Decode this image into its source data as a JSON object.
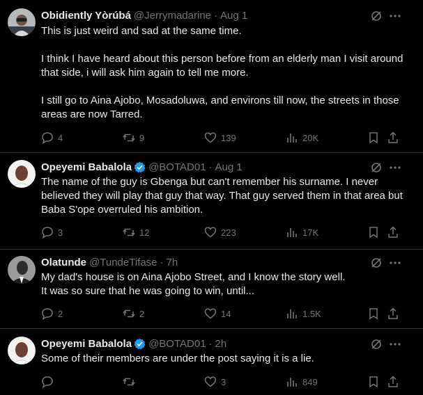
{
  "tweets": [
    {
      "name": "Obidiently Yòrúbá",
      "handle": "@Jerrymadarine",
      "dot": "·",
      "time": "Aug 1",
      "verified": false,
      "lines": [
        "This is just weird and sad at the same time.",
        "I think I have heard about this person before from an elderly man I visit around that side, i will ask him again to tell me more.",
        "I still go to Aina Ajobo, Mosadoluwa, and environs till now, the streets in those areas are now Tarred."
      ],
      "replies": "4",
      "reposts": "9",
      "likes": "139",
      "views": "20K"
    },
    {
      "name": "Opeyemi Babalola",
      "handle": "@BOTAD01",
      "dot": "·",
      "time": "Aug 1",
      "verified": true,
      "lines": [
        "The name of the guy is Gbenga but can't remember his surname. I never believed they will play that guy that way. That guy served them in that area but Baba S'ope overruled his ambition."
      ],
      "replies": "3",
      "reposts": "12",
      "likes": "223",
      "views": "17K"
    },
    {
      "name": "Olatunde",
      "handle": "@TundeTifase",
      "dot": "·",
      "time": "7h",
      "verified": false,
      "lines": [
        "My dad's house is on Aina Ajobo Street, and I know the story well.",
        "It was so sure that he was going to win, until..."
      ],
      "replies": "2",
      "reposts": "2",
      "likes": "14",
      "views": "1.5K"
    },
    {
      "name": "Opeyemi Babalola",
      "handle": "@BOTAD01",
      "dot": "·",
      "time": "2h",
      "verified": true,
      "lines": [
        "Some of their members are under the post saying it is a lie."
      ],
      "replies": "",
      "reposts": "",
      "likes": "3",
      "views": "849"
    }
  ],
  "colors": {
    "background": "#000000",
    "text": "#e7e9ea",
    "muted": "#71767b",
    "divider": "#2f3336",
    "verified": "#1d9bf0"
  },
  "icons": [
    "grok-icon",
    "more-icon",
    "reply-icon",
    "repost-icon",
    "like-icon",
    "views-icon",
    "bookmark-icon",
    "share-icon",
    "verified-badge-icon"
  ]
}
